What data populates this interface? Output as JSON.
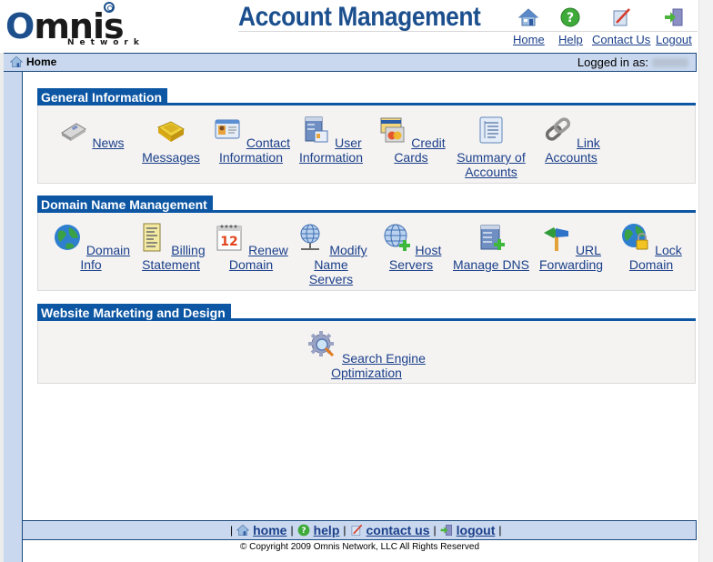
{
  "header": {
    "logo_main": "Omnis",
    "logo_sub": "Network",
    "title": "Account Management",
    "links": [
      {
        "label": "Home",
        "icon": "home-icon"
      },
      {
        "label": "Help",
        "icon": "help-icon"
      },
      {
        "label": "Contact Us",
        "icon": "contact-icon"
      },
      {
        "label": "Logout",
        "icon": "logout-icon"
      }
    ]
  },
  "nav": {
    "breadcrumb": "Home",
    "logged_in_label": "Logged in as:"
  },
  "sections": [
    {
      "title": "General Information",
      "items": [
        {
          "label": "News",
          "icon": "newspaper-icon"
        },
        {
          "label": "Messages",
          "icon": "inbox-tray-icon"
        },
        {
          "label": "Contact Information",
          "icon": "id-card-icon"
        },
        {
          "label": "User Information",
          "icon": "user-server-icon"
        },
        {
          "label": "Credit Cards",
          "icon": "credit-card-icon"
        },
        {
          "label": "Summary of Accounts",
          "icon": "tree-list-icon"
        },
        {
          "label": "Link Accounts",
          "icon": "chain-link-icon"
        }
      ]
    },
    {
      "title": "Domain Name Management",
      "items": [
        {
          "label": "Domain Info",
          "icon": "globe-icon"
        },
        {
          "label": "Billing Statement",
          "icon": "statement-icon"
        },
        {
          "label": "Renew Domain",
          "icon": "calendar-icon",
          "badge": "12"
        },
        {
          "label": "Modify Name Servers",
          "icon": "network-globe-icon"
        },
        {
          "label": "Host Servers",
          "icon": "globe-add-icon"
        },
        {
          "label": "Manage DNS",
          "icon": "server-add-icon"
        },
        {
          "label": "URL Forwarding",
          "icon": "signpost-icon"
        },
        {
          "label": "Lock Domain",
          "icon": "globe-lock-icon"
        }
      ]
    },
    {
      "title": "Website Marketing and Design",
      "items": [
        {
          "label": "Search Engine Optimization",
          "icon": "gear-search-icon"
        }
      ]
    }
  ],
  "footer": {
    "links": [
      {
        "label": "home",
        "icon": "home-icon"
      },
      {
        "label": "help",
        "icon": "help-icon"
      },
      {
        "label": "contact us",
        "icon": "contact-icon"
      },
      {
        "label": "logout",
        "icon": "logout-icon"
      }
    ],
    "copyright": "© Copyright 2009 Omnis Network, LLC All Rights Reserved"
  },
  "colors": {
    "brand_blue": "#0c56a3",
    "title_blue": "#1c4f8e",
    "frame_blue": "#c9d8ee",
    "link_blue": "#1b3f8a",
    "panel_bg": "#f4f3f2"
  }
}
